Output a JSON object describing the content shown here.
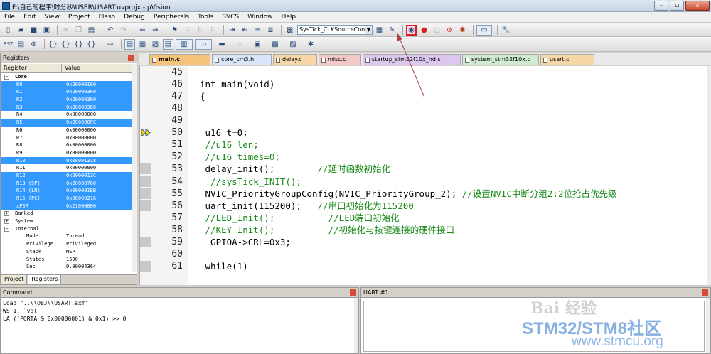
{
  "window": {
    "title": "F:\\自己的程序\\时分秒\\USER\\USART.uvprojx - µVision",
    "controls": [
      "-",
      "▫",
      "x"
    ]
  },
  "menu": [
    "File",
    "Edit",
    "View",
    "Project",
    "Flash",
    "Debug",
    "Peripherals",
    "Tools",
    "SVCS",
    "Window",
    "Help"
  ],
  "toolbar": {
    "target_combo": "SysTick_CLKSourceConfig"
  },
  "registers_panel": {
    "title": "Registers",
    "col_register": "Register",
    "col_value": "Value",
    "core_label": "Core",
    "rows": [
      {
        "name": "R0",
        "value": "0x20000160",
        "selected": true
      },
      {
        "name": "R1",
        "value": "0x20000360",
        "selected": true
      },
      {
        "name": "R2",
        "value": "0x20000360",
        "selected": true
      },
      {
        "name": "R3",
        "value": "0x20000360",
        "selected": true
      },
      {
        "name": "R4",
        "value": "0x00000000",
        "selected": false
      },
      {
        "name": "R5",
        "value": "0x200000FC",
        "selected": true
      },
      {
        "name": "R6",
        "value": "0x00000000",
        "selected": false
      },
      {
        "name": "R7",
        "value": "0x00000000",
        "selected": false
      },
      {
        "name": "R8",
        "value": "0x00000000",
        "selected": false
      },
      {
        "name": "R9",
        "value": "0x00000000",
        "selected": false
      },
      {
        "name": "R10",
        "value": "0x08001318",
        "selected": true
      },
      {
        "name": "R11",
        "value": "0x00000000",
        "selected": false
      },
      {
        "name": "R12",
        "value": "0x2000013C",
        "selected": true
      },
      {
        "name": "R13 (SP)",
        "value": "0x20000760",
        "selected": true
      },
      {
        "name": "R14 (LR)",
        "value": "0x080001BB",
        "selected": true
      },
      {
        "name": "R15 (PC)",
        "value": "0x08000216",
        "selected": true
      },
      {
        "name": "xPSR",
        "value": "0x21000000",
        "selected": true
      }
    ],
    "groups": [
      "Banked",
      "System",
      "Internal"
    ],
    "internal": [
      {
        "name": "Mode",
        "value": "Thread"
      },
      {
        "name": "Privilege",
        "value": "Privileged"
      },
      {
        "name": "Stack",
        "value": "MSP"
      },
      {
        "name": "States",
        "value": "1590"
      },
      {
        "name": "Sec",
        "value": "0.00004364"
      }
    ],
    "tabs": [
      "Project",
      "Registers"
    ]
  },
  "editor": {
    "tabs": [
      {
        "label": "main.c",
        "color": "#f5c37a",
        "active": true
      },
      {
        "label": "core_cm3.h",
        "color": "#d7e6f8"
      },
      {
        "label": "delay.c",
        "color": "#f7d7a8"
      },
      {
        "label": "misc.c",
        "color": "#f4c8c8"
      },
      {
        "label": "startup_stm32f10x_hd.s",
        "color": "#dcc8ee"
      },
      {
        "label": "system_stm32f10x.c",
        "color": "#cfead0"
      },
      {
        "label": "usart.c",
        "color": "#f7d7a8"
      }
    ],
    "lines": [
      {
        "no": "45",
        "code": ""
      },
      {
        "no": "46",
        "code": "int main(void)"
      },
      {
        "no": "47",
        "code": "{"
      },
      {
        "no": "48",
        "code": ""
      },
      {
        "no": "49",
        "code": ""
      },
      {
        "no": "50",
        "code": " u16 t=0;"
      },
      {
        "no": "51",
        "code": " //u16 len;"
      },
      {
        "no": "52",
        "code": " //u16 times=0;"
      },
      {
        "no": "53",
        "code": " delay_init();        //延时函数初始化"
      },
      {
        "no": "54",
        "code": "  //sysTick_INIT();"
      },
      {
        "no": "55",
        "code": " NVIC_PriorityGroupConfig(NVIC_PriorityGroup_2); //设置NVIC中断分组2:2位抢占优先级"
      },
      {
        "no": "56",
        "code": " uart_init(115200);   //串口初始化为115200"
      },
      {
        "no": "57",
        "code": " //LED_Init();          //LED端口初始化"
      },
      {
        "no": "58",
        "code": " //KEY_Init();          //初始化与按键连接的硬件接口"
      },
      {
        "no": "59",
        "code": "  GPIOA->CRL=0x3;"
      },
      {
        "no": "60",
        "code": ""
      },
      {
        "no": "61",
        "code": " while(1)"
      }
    ]
  },
  "command_panel": {
    "title": "Command",
    "output": "Load \"..\\\\OBJ\\\\USART.axf\"\nWS 1, `val\nLA ((PORTA & 0x00000001) & 0x1) >> 0"
  },
  "uart_panel": {
    "title": "UART #1"
  },
  "watermark": {
    "line1": "Bai 经验",
    "line2": "STM32/STM8社区",
    "line3": "www.stmcu.org"
  }
}
